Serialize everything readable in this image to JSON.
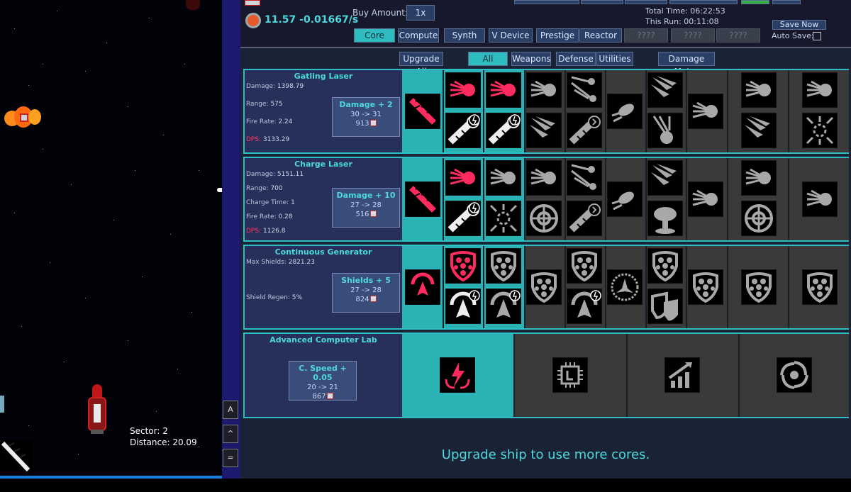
{
  "resource": {
    "rate": "11.57 -0.01667/s"
  },
  "buy": {
    "label": "Buy Amount:",
    "value": "1x"
  },
  "time": {
    "total": "Total Time: 06:22:53",
    "run": "This Run: 00:11:08"
  },
  "save": {
    "button": "Save Now",
    "auto": "Auto Save:"
  },
  "tabs": [
    "Core",
    "Compute",
    "Synth",
    "V Device",
    "Prestige",
    "Reactor",
    "????",
    "????",
    "????"
  ],
  "filters": {
    "upgrade_all": "Upgrade All",
    "items": [
      "All",
      "Weapons",
      "Defense",
      "Utilities"
    ],
    "damage_meter": "Damage Meter"
  },
  "sections": [
    {
      "title": "Gatling Laser",
      "stats": [
        {
          "k": "Damage:",
          "v": "1398.79"
        },
        {
          "k": "Range:",
          "v": "575"
        },
        {
          "k": "Fire Rate:",
          "v": "2.24"
        },
        {
          "k": "DPS:",
          "v": "3133.29"
        }
      ],
      "upgrade": {
        "name": "Damage + 2",
        "change": "30 -> 31",
        "cost": "913"
      }
    },
    {
      "title": "Charge Laser",
      "stats": [
        {
          "k": "Damage:",
          "v": "5151.11"
        },
        {
          "k": "Range:",
          "v": "700"
        },
        {
          "k": "Charge Time:",
          "v": "1"
        },
        {
          "k": "Fire Rate:",
          "v": "0.28"
        },
        {
          "k": "DPS:",
          "v": "1126.8"
        }
      ],
      "upgrade": {
        "name": "Damage + 10",
        "change": "27 -> 28",
        "cost": "516"
      }
    },
    {
      "title": "Continuous Generator",
      "stats": [
        {
          "k": "Max Shields:",
          "v": "2821.23"
        },
        {
          "k": "Shield Regen:",
          "v": "5%"
        }
      ],
      "upgrade": {
        "name": "Shields + 5",
        "change": "27 -> 28",
        "cost": "824"
      }
    },
    {
      "title": "Advanced Computer Lab",
      "stats": [],
      "upgrade": {
        "name": "C. Speed + 0.05",
        "change": "20 -> 21",
        "cost": "867"
      }
    }
  ],
  "ship": {
    "sector": "Sector: 2",
    "distance": "Distance: 20.09"
  },
  "side_buttons": [
    "A",
    "^",
    "="
  ],
  "cores_msg": "Upgrade ship to use more cores.",
  "colors": {
    "teal": "#2bb2b4",
    "accent": "#4cd8dc",
    "pink": "#ff2b5e"
  }
}
